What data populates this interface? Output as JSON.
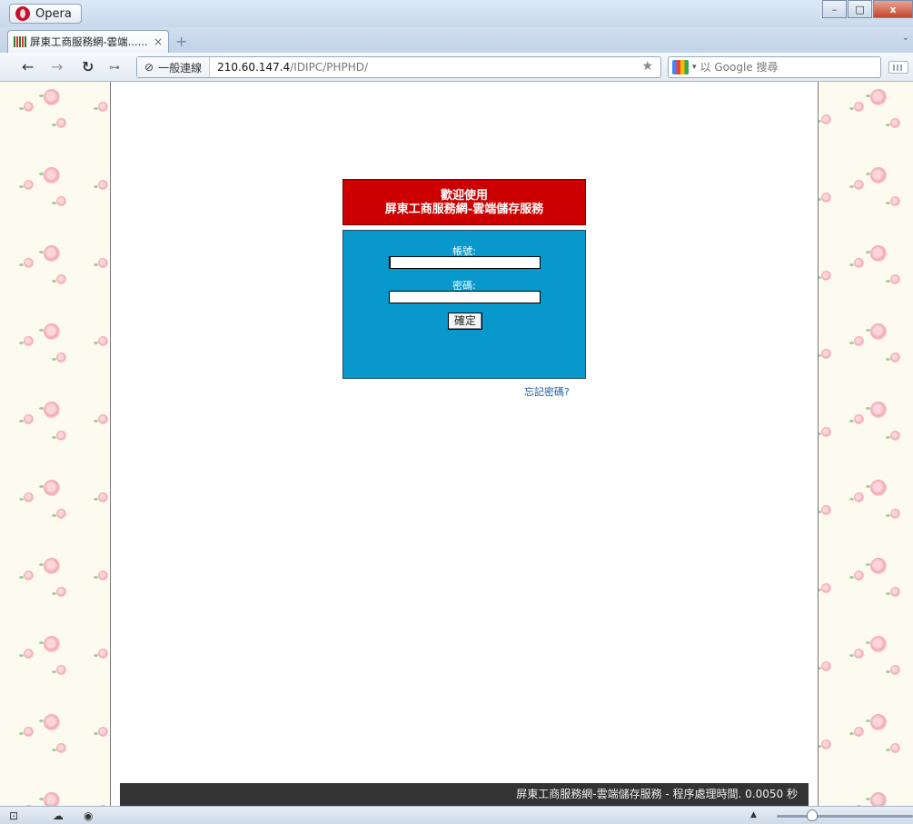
{
  "browser": {
    "app_name": "Opera",
    "tab_title": "屏東工商服務網-雲端......",
    "tab_close": "×",
    "new_tab": "+",
    "back": "←",
    "forward": "→",
    "reload": "↻",
    "security_label": "一般連線",
    "url_host": "210.60.147.4",
    "url_path": "/IDIPC/PHPHD/",
    "search_placeholder": "以 Google 搜尋",
    "window_controls": [
      "–",
      "□",
      "x"
    ]
  },
  "page": {
    "header_line1": "歡迎使用",
    "header_line2": "屏東工商服務網-雲端儲存服務",
    "account_label": "帳號:",
    "password_label": "密碼:",
    "account_value": "",
    "password_value": "",
    "submit_label": "確定",
    "forgot_link": "忘記密碼?",
    "footer_text": "屏東工商服務網-雲端儲存服務 - 程序處理時間. 0.0050 秒"
  },
  "colors": {
    "header_bg": "#cc0000",
    "login_bg": "#0898cc",
    "footer_bg": "#333333",
    "forgot_link": "#1a5aa8"
  },
  "icons": {
    "opera_logo": "opera-logo-icon",
    "favicon": "site-favicon-icon",
    "security": "globe-icon",
    "bookmark": "star-icon",
    "search_engine": "google-icon",
    "key": "key-icon",
    "statusbar": [
      "panel-icon",
      "cloud-icon",
      "speed-dial-icon"
    ]
  },
  "statusbar": {
    "zoom_percent": 100
  }
}
